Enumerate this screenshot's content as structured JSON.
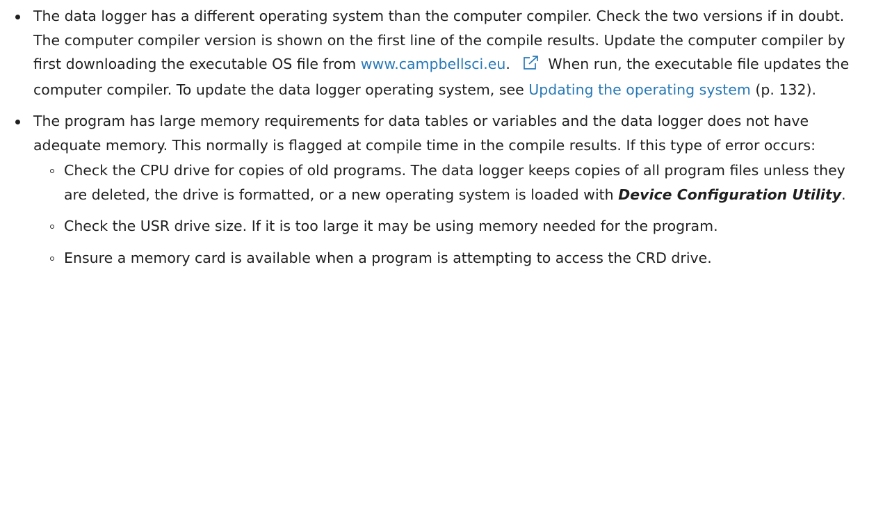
{
  "bullets": [
    {
      "segments": {
        "text1": "The data logger has a different operating system than the computer compiler. Check the two versions if in doubt. The computer compiler version is shown on the first line of the compile results. Update the computer compiler by first downloading the executable OS file from ",
        "link1": "www.campbellsci.eu",
        "link1_suffix": ".",
        "text2": " When run, the executable file updates the computer compiler. To update the data logger operating system, see ",
        "link2": "Updating the operating system",
        "text3": " (p. 132)."
      },
      "icon": "external-link-icon"
    },
    {
      "text": "The program has large memory requirements for data tables or variables and the data logger does not have adequate memory. This normally is flagged at compile time in the compile results. If this type of error occurs:",
      "subitems": [
        {
          "text_before": "Check the CPU drive for copies of old programs. The data logger keeps copies of all program files unless they are deleted, the drive is formatted, or a new operating system is loaded with ",
          "emphasis": "Device Configuration Utility",
          "text_after": "."
        },
        {
          "text": "Check the USR drive size. If it is too large it may be using memory needed for the program."
        },
        {
          "text": "Ensure a memory card is available when a program is attempting to access the CRD drive."
        }
      ]
    }
  ],
  "colors": {
    "text": "#1f1f1f",
    "link": "#2779b7"
  }
}
